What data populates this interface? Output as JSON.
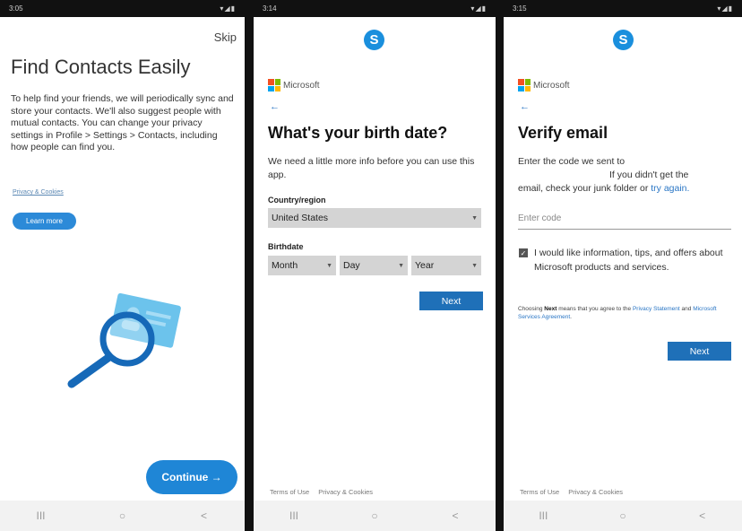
{
  "phone1": {
    "status": {
      "time": "3:05",
      "right": "▾◢▮"
    },
    "skip": "Skip",
    "title": "Find Contacts Easily",
    "body": "To help find your friends, we will periodically sync and store your contacts. We'll also suggest people with mutual contacts. You can change your privacy settings in Profile > Settings > Contacts, including how people can find you.",
    "privacy_link": "Privacy & Cookies",
    "learn_more": "Learn more",
    "continue": "Continue →"
  },
  "phone2": {
    "status": {
      "time": "3:14",
      "right": "▾◢▮"
    },
    "skype_icon": "skype-icon",
    "brand": "Microsoft",
    "back": "←",
    "title": "What's your birth date?",
    "intro": "We need a little more info before you can use this app.",
    "country_label": "Country/region",
    "country_value": "United States",
    "birthdate_label": "Birthdate",
    "month": "Month",
    "day": "Day",
    "year": "Year",
    "next": "Next",
    "terms": "Terms of Use",
    "privacy": "Privacy & Cookies"
  },
  "phone3": {
    "status": {
      "time": "3:15",
      "right": "▾◢▮"
    },
    "brand": "Microsoft",
    "back": "←",
    "title": "Verify email",
    "text_line1": "Enter the code we sent to",
    "text_line2": "If you didn't get the",
    "text_line3": "email, check your junk folder or",
    "try_again": "try again.",
    "code_placeholder": "Enter code",
    "checkbox_label": "I would like information, tips, and offers about Microsoft products and services.",
    "note_prefix": "Choosing",
    "note_bold": "Next",
    "note_mid": "means that you agree to the",
    "note_link1": "Privacy Statement",
    "note_and": "and",
    "note_link2": "Microsoft Services Agreement",
    "note_end": ".",
    "next": "Next",
    "terms": "Terms of Use",
    "privacy": "Privacy & Cookies"
  },
  "nav": {
    "recent": "III",
    "home": "○",
    "back": "<"
  },
  "colors": {
    "accent": "#1f86d6",
    "ms_button": "#1f70b8",
    "link": "#2a76c5"
  }
}
